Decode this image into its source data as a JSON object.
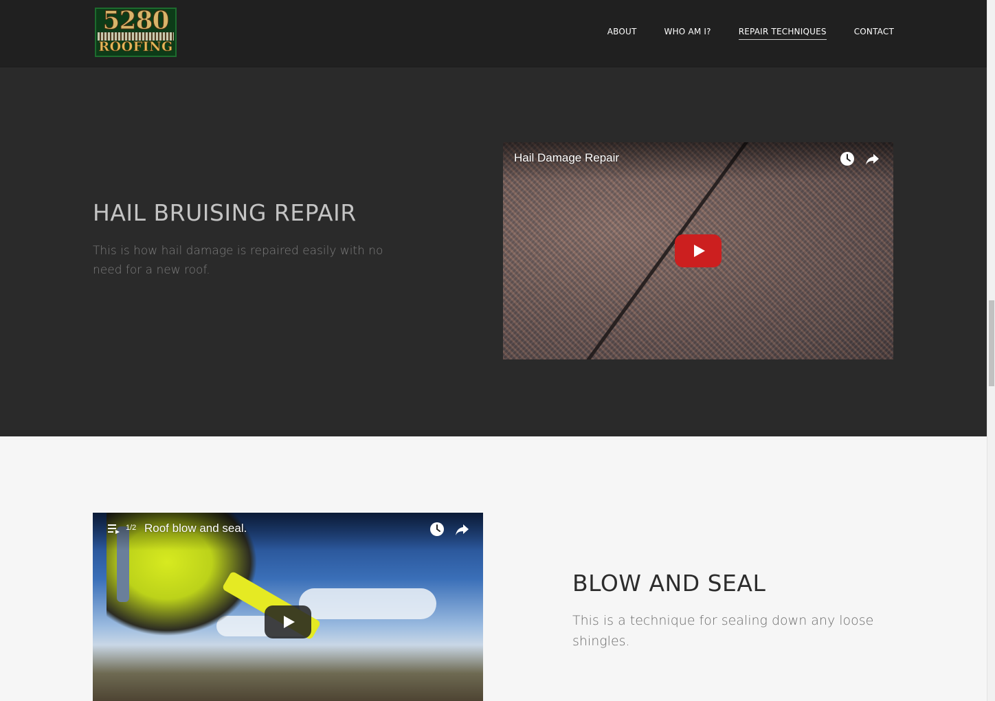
{
  "header": {
    "logo": {
      "number": "5280",
      "word": "ROOFING"
    },
    "nav": [
      {
        "label": "ABOUT",
        "active": false
      },
      {
        "label": "WHO AM I?",
        "active": false
      },
      {
        "label": "REPAIR TECHNIQUES",
        "active": true
      },
      {
        "label": "CONTACT",
        "active": false
      }
    ]
  },
  "sections": [
    {
      "title": "HAIL BRUISING REPAIR",
      "description": "This is how hail damage is repaired easily with no need for a new roof.",
      "video": {
        "title": "Hail Damage Repair",
        "icons": [
          "clock-icon",
          "share-icon"
        ],
        "play_button_color": "#cc1f1f"
      }
    },
    {
      "title": "BLOW AND SEAL",
      "description": "This is a technique for sealing down any loose shingles.",
      "video": {
        "title": "Roof blow and seal.",
        "playlist_counter": "1/2",
        "icons": [
          "playlist-icon",
          "clock-icon",
          "share-icon"
        ],
        "play_button_color": "#212121"
      }
    }
  ],
  "colors": {
    "header_bg": "#202020",
    "dark_section_bg": "#2a2a2a",
    "light_section_bg": "#f6f6f6"
  }
}
